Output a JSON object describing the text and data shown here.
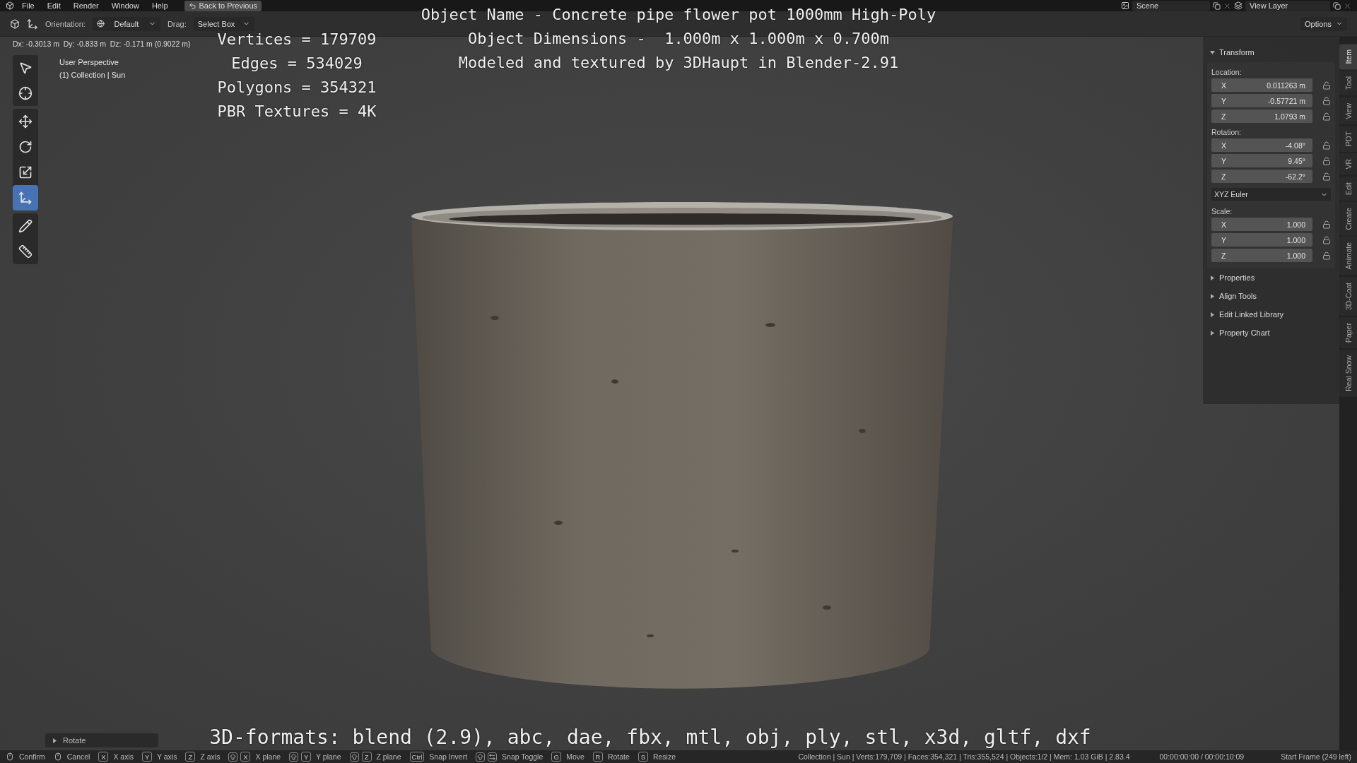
{
  "menu": {
    "items": [
      "File",
      "Edit",
      "Render",
      "Window",
      "Help"
    ],
    "back_button": "Back to Previous",
    "scene": "Scene",
    "view_layer": "View Layer"
  },
  "header": {
    "orientation_label": "Orientation:",
    "orientation": "Default",
    "drag_label": "Drag:",
    "drag": "Select Box",
    "options": "Options"
  },
  "delta": "Dx: -0.3013 m  Dy: -0.833 m  Dz: -0.171 m (0.9022 m)",
  "viewport": {
    "perspective": "User Perspective",
    "collection": "(1) Collection | Sun"
  },
  "tools": [
    {
      "kind": "select",
      "selected": false
    },
    {
      "kind": "cursor",
      "selected": false
    },
    {
      "kind": "move",
      "selected": false
    },
    {
      "kind": "rotate",
      "selected": false
    },
    {
      "kind": "scale",
      "selected": false
    },
    {
      "kind": "transform",
      "selected": true
    },
    {
      "kind": "annotate",
      "selected": false
    },
    {
      "kind": "measure",
      "selected": false
    }
  ],
  "overlay": {
    "info": [
      "Object Name - Concrete pipe flower pot 1000mm High-Poly",
      "Object Dimensions -  1.000m x 1.000m x 0.700m",
      "Modeled and textured by 3DHaupt in Blender-2.91"
    ],
    "stats": [
      "Vertices = 179709",
      "Edges = 534029",
      "Polygons = 354321",
      "PBR Textures = 4K"
    ],
    "formats": "3D-formats: blend (2.9), abc, dae, fbx, mtl, obj, ply, stl, x3d, gltf, dxf"
  },
  "last_operator": {
    "title": "Rotate",
    "expanded": false
  },
  "panel": {
    "transform": {
      "title": "Transform",
      "expanded": true,
      "groups": [
        {
          "label": "Location:",
          "rows": [
            {
              "axis": "X",
              "value": "0.011263 m"
            },
            {
              "axis": "Y",
              "value": "-0.57721 m"
            },
            {
              "axis": "Z",
              "value": "1.0793 m"
            }
          ]
        },
        {
          "label": "Rotation:",
          "rows": [
            {
              "axis": "X",
              "value": "-4.08°"
            },
            {
              "axis": "Y",
              "value": "9.45°"
            },
            {
              "axis": "Z",
              "value": "-62.2°"
            }
          ],
          "mode": "XYZ Euler"
        },
        {
          "label": "Scale:",
          "rows": [
            {
              "axis": "X",
              "value": "1.000"
            },
            {
              "axis": "Y",
              "value": "1.000"
            },
            {
              "axis": "Z",
              "value": "1.000"
            }
          ]
        }
      ]
    },
    "sections": [
      {
        "title": "Properties",
        "expanded": false
      },
      {
        "title": "Align Tools",
        "expanded": false
      },
      {
        "title": "Edit Linked Library",
        "expanded": false
      },
      {
        "title": "Property Chart",
        "expanded": false
      }
    ]
  },
  "tabs": [
    {
      "label": "Item",
      "selected": true
    },
    {
      "label": "Tool",
      "selected": false
    },
    {
      "label": "View",
      "selected": false
    },
    {
      "label": "PDT",
      "selected": false
    },
    {
      "label": "VR",
      "selected": false
    },
    {
      "label": "Edit",
      "selected": false
    },
    {
      "label": "Create",
      "selected": false
    },
    {
      "label": "Animate",
      "selected": false
    },
    {
      "label": "3D-Coat",
      "selected": false
    },
    {
      "label": "Paper",
      "selected": false
    },
    {
      "label": "Real Snow",
      "selected": false
    }
  ],
  "status": {
    "hints": [
      {
        "kind": "mouse",
        "label": "Confirm"
      },
      {
        "kind": "mouse",
        "label": "Cancel"
      },
      {
        "kind": "key",
        "key": "X",
        "label": "X axis"
      },
      {
        "kind": "key",
        "key": "Y",
        "label": "Y axis"
      },
      {
        "kind": "key",
        "key": "Z",
        "label": "Z axis"
      },
      {
        "kind": "shift",
        "key": "X",
        "label": "X plane"
      },
      {
        "kind": "shift",
        "key": "Y",
        "label": "Y plane"
      },
      {
        "kind": "shift",
        "key": "Z",
        "label": "Z plane"
      },
      {
        "kind": "key",
        "key": "Ctrl",
        "label": "Snap Invert"
      },
      {
        "kind": "shift-icon",
        "label": "Snap Toggle"
      },
      {
        "kind": "key",
        "key": "G",
        "label": "Move"
      },
      {
        "kind": "key",
        "key": "R",
        "label": "Rotate"
      },
      {
        "kind": "key",
        "key": "S",
        "label": "Resize"
      }
    ],
    "info": "Collection | Sun | Verts:179,709 | Faces:354,321 | Tris:355,524 | Objects:1/2 | Mem: 1.03 GiB | 2.83.4",
    "time": "00:00:00:00 / 00:00:10:09",
    "frame": "Start Frame (249 left)"
  }
}
